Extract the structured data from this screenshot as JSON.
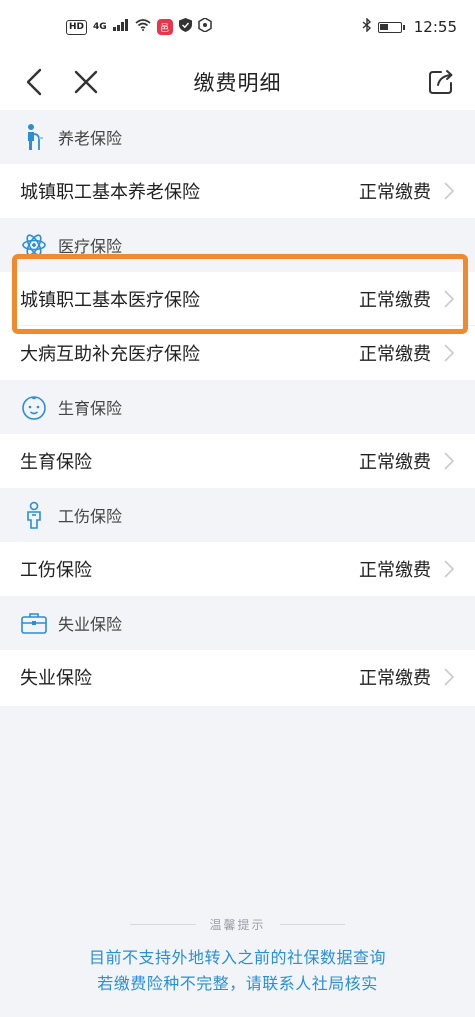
{
  "status_bar": {
    "left": {
      "hd": "HD",
      "net": "4G",
      "app_badge": "邑"
    },
    "time": "12:55"
  },
  "nav": {
    "title": "缴费明细",
    "icons": [
      "back-arrow-icon",
      "close-icon",
      "share-icon"
    ]
  },
  "sections": [
    {
      "title": "养老保险",
      "icon": "elderly-person-icon",
      "items": [
        {
          "label": "城镇职工基本养老保险",
          "status": "正常缴费"
        }
      ]
    },
    {
      "title": "医疗保险",
      "icon": "medical-atom-icon",
      "items": [
        {
          "label": "城镇职工基本医疗保险",
          "status": "正常缴费"
        },
        {
          "label": "大病互助补充医疗保险",
          "status": "正常缴费"
        }
      ]
    },
    {
      "title": "生育保险",
      "icon": "baby-face-icon",
      "items": [
        {
          "label": "生育保险",
          "status": "正常缴费"
        }
      ]
    },
    {
      "title": "工伤保险",
      "icon": "worker-icon",
      "items": [
        {
          "label": "工伤保险",
          "status": "正常缴费"
        }
      ]
    },
    {
      "title": "失业保险",
      "icon": "briefcase-icon",
      "items": [
        {
          "label": "失业保险",
          "status": "正常缴费"
        }
      ]
    }
  ],
  "tips": {
    "title": "温馨提示",
    "line1": "目前不支持外地转入之前的社保数据查询",
    "line2": "若缴费险种不完整，请联系人社局核实"
  },
  "colors": {
    "accent_blue": "#2a8fd6",
    "highlight_orange": "#f08a2e",
    "section_bg": "#f3f4f7"
  }
}
